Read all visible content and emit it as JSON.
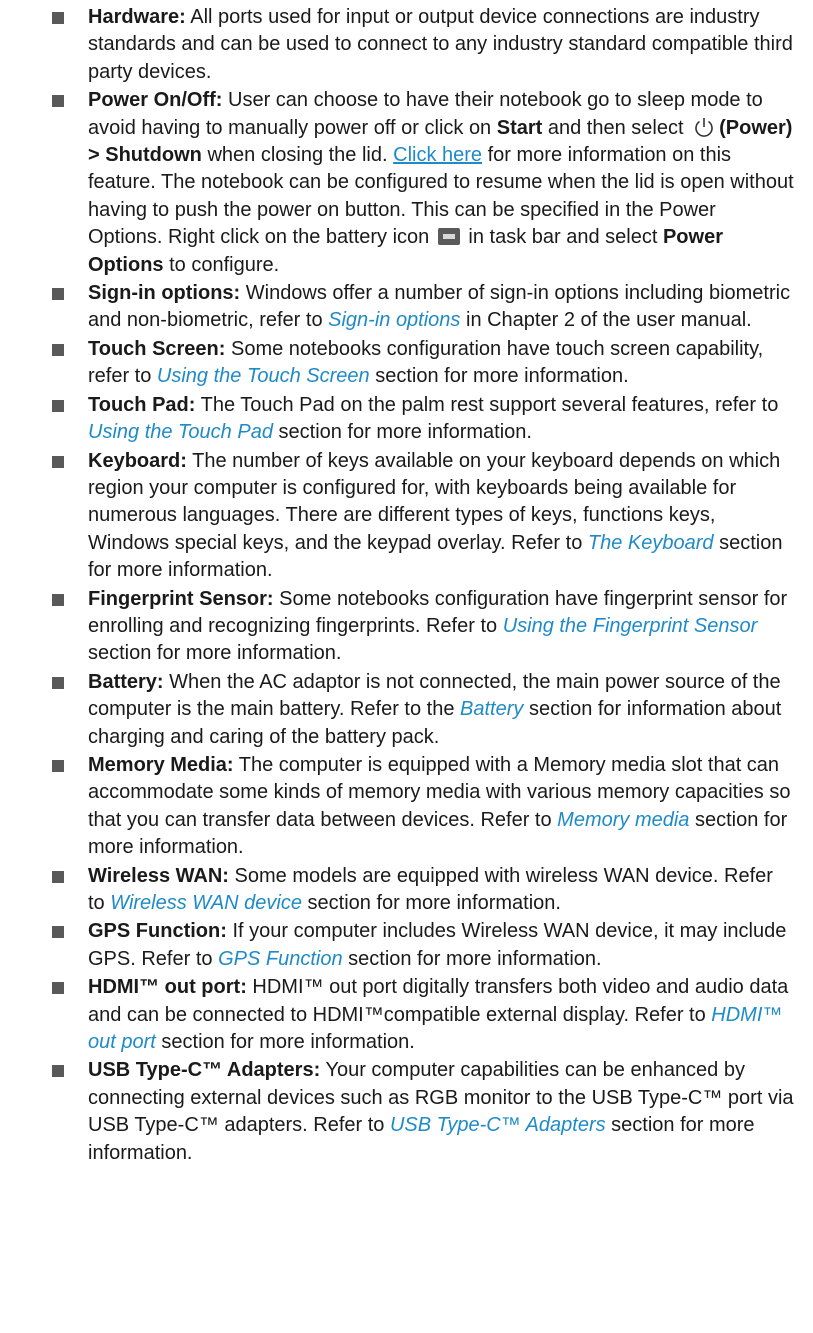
{
  "items": [
    {
      "title": "Hardware:",
      "text": " All ports used for input or output device connections are industry standards and can be used to connect to any industry standard compatible third party devices."
    },
    {
      "title": "Power On/Off:",
      "t1": " User can choose to have their notebook go to sleep mode to avoid having to manually power off or click on ",
      "start": "Start",
      "t2": " and then select ",
      "power_label": "(Power) > Shutdown",
      "t3": " when closing the lid. ",
      "link": "Click here",
      "t4": " for more information on this feature. The notebook can be configured to resume when the lid is open without having to push the power on button. This can be specified in the Power Options. Right click on the battery icon ",
      "t5": " in task bar and select ",
      "power_options": "Power Options",
      "t6": " to configure."
    },
    {
      "title": "Sign-in options:",
      "t1": " Windows offer a number of sign-in options including biometric and non-biometric, refer to ",
      "xref": "Sign-in options",
      "t2": " in Chapter 2 of the user manual."
    },
    {
      "title": "Touch Screen:",
      "t1": " Some notebooks configuration have touch screen capability, refer to ",
      "xref": "Using the Touch Screen",
      "t2": " section for more information."
    },
    {
      "title": "Touch Pad:",
      "t1": " The Touch Pad on the palm rest support several features, refer to ",
      "xref": "Using the Touch Pad",
      "t2": " section for more information."
    },
    {
      "title": "Keyboard:",
      "t1": " The number of keys available on your keyboard depends on which region your computer is configured for, with keyboards being available for numerous languages. There are different types of keys, functions keys, Windows special keys, and the keypad overlay. Refer to ",
      "xref": "The Keyboard",
      "t2": " section for more information."
    },
    {
      "title": "Fingerprint Sensor:",
      "t1": " Some notebooks configuration have fingerprint sensor for enrolling and recognizing fingerprints. Refer to ",
      "xref": "Using the Fingerprint Sensor",
      "t2": " section for more information."
    },
    {
      "title": "Battery:",
      "t1": " When the AC adaptor is not connected, the main power source of the computer is the main battery. Refer to the ",
      "xref": "Battery",
      "t2": " section for information about charging and caring of the battery pack."
    },
    {
      "title": "Memory Media:",
      "t1": " The computer is equipped with a Memory media slot that can accommodate some kinds of memory media with various memory capacities so that you can transfer data between devices. Refer to ",
      "xref": "Memory media",
      "t2": " section for more information."
    },
    {
      "title": "Wireless WAN:",
      "t1": " Some models are equipped with wireless WAN device. Refer to ",
      "xref": "Wireless WAN device",
      "t2": " section for more information."
    },
    {
      "title": "GPS Function:",
      "t1": " If your computer includes Wireless WAN device, it may include GPS. Refer to ",
      "xref": "GPS Function",
      "t2": " section for more information."
    },
    {
      "title": "HDMI™ out port:",
      "t1": " HDMI™ out port digitally transfers both video and audio data and can be connected to HDMI™compatible external display. Refer to ",
      "xref": "HDMI™ out port",
      "t2": " section for more information."
    },
    {
      "title": "USB Type-C™ Adapters:",
      "t1": " Your computer capabilities can be enhanced by connecting external devices such as RGB monitor to the USB Type-C™ port via USB Type-C™ adapters. Refer to ",
      "xref": "USB Type-C™ Adapters",
      "t2": " section for more information."
    }
  ],
  "colors": {
    "link": "#1e8bc7",
    "bullet": "#595959",
    "text": "#1a1a1a"
  },
  "icons": {
    "power": "power-icon",
    "battery": "battery-icon"
  }
}
